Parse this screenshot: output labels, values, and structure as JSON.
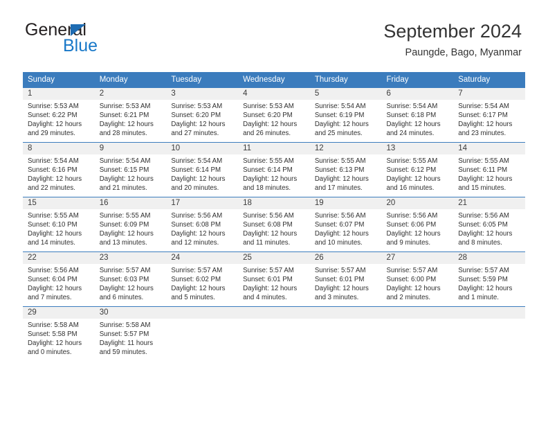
{
  "brand": {
    "word_one": "General",
    "word_two": "Blue",
    "triangle_color": "#1e6cb3",
    "blue_color": "#1878c8"
  },
  "header": {
    "month_title": "September 2024",
    "location": "Paungde, Bago, Myanmar"
  },
  "theme": {
    "header_bg": "#3b7cbd",
    "header_text": "#ffffff",
    "daynum_band_bg": "#f0f0f0",
    "grid_line": "#3b7cbd",
    "body_text": "#2f2f2f"
  },
  "weekday_headers": [
    "Sunday",
    "Monday",
    "Tuesday",
    "Wednesday",
    "Thursday",
    "Friday",
    "Saturday"
  ],
  "weeks": [
    [
      {
        "day": "1",
        "sunrise": "Sunrise: 5:53 AM",
        "sunset": "Sunset: 6:22 PM",
        "daylight_1": "Daylight: 12 hours",
        "daylight_2": "and 29 minutes."
      },
      {
        "day": "2",
        "sunrise": "Sunrise: 5:53 AM",
        "sunset": "Sunset: 6:21 PM",
        "daylight_1": "Daylight: 12 hours",
        "daylight_2": "and 28 minutes."
      },
      {
        "day": "3",
        "sunrise": "Sunrise: 5:53 AM",
        "sunset": "Sunset: 6:20 PM",
        "daylight_1": "Daylight: 12 hours",
        "daylight_2": "and 27 minutes."
      },
      {
        "day": "4",
        "sunrise": "Sunrise: 5:53 AM",
        "sunset": "Sunset: 6:20 PM",
        "daylight_1": "Daylight: 12 hours",
        "daylight_2": "and 26 minutes."
      },
      {
        "day": "5",
        "sunrise": "Sunrise: 5:54 AM",
        "sunset": "Sunset: 6:19 PM",
        "daylight_1": "Daylight: 12 hours",
        "daylight_2": "and 25 minutes."
      },
      {
        "day": "6",
        "sunrise": "Sunrise: 5:54 AM",
        "sunset": "Sunset: 6:18 PM",
        "daylight_1": "Daylight: 12 hours",
        "daylight_2": "and 24 minutes."
      },
      {
        "day": "7",
        "sunrise": "Sunrise: 5:54 AM",
        "sunset": "Sunset: 6:17 PM",
        "daylight_1": "Daylight: 12 hours",
        "daylight_2": "and 23 minutes."
      }
    ],
    [
      {
        "day": "8",
        "sunrise": "Sunrise: 5:54 AM",
        "sunset": "Sunset: 6:16 PM",
        "daylight_1": "Daylight: 12 hours",
        "daylight_2": "and 22 minutes."
      },
      {
        "day": "9",
        "sunrise": "Sunrise: 5:54 AM",
        "sunset": "Sunset: 6:15 PM",
        "daylight_1": "Daylight: 12 hours",
        "daylight_2": "and 21 minutes."
      },
      {
        "day": "10",
        "sunrise": "Sunrise: 5:54 AM",
        "sunset": "Sunset: 6:14 PM",
        "daylight_1": "Daylight: 12 hours",
        "daylight_2": "and 20 minutes."
      },
      {
        "day": "11",
        "sunrise": "Sunrise: 5:55 AM",
        "sunset": "Sunset: 6:14 PM",
        "daylight_1": "Daylight: 12 hours",
        "daylight_2": "and 18 minutes."
      },
      {
        "day": "12",
        "sunrise": "Sunrise: 5:55 AM",
        "sunset": "Sunset: 6:13 PM",
        "daylight_1": "Daylight: 12 hours",
        "daylight_2": "and 17 minutes."
      },
      {
        "day": "13",
        "sunrise": "Sunrise: 5:55 AM",
        "sunset": "Sunset: 6:12 PM",
        "daylight_1": "Daylight: 12 hours",
        "daylight_2": "and 16 minutes."
      },
      {
        "day": "14",
        "sunrise": "Sunrise: 5:55 AM",
        "sunset": "Sunset: 6:11 PM",
        "daylight_1": "Daylight: 12 hours",
        "daylight_2": "and 15 minutes."
      }
    ],
    [
      {
        "day": "15",
        "sunrise": "Sunrise: 5:55 AM",
        "sunset": "Sunset: 6:10 PM",
        "daylight_1": "Daylight: 12 hours",
        "daylight_2": "and 14 minutes."
      },
      {
        "day": "16",
        "sunrise": "Sunrise: 5:55 AM",
        "sunset": "Sunset: 6:09 PM",
        "daylight_1": "Daylight: 12 hours",
        "daylight_2": "and 13 minutes."
      },
      {
        "day": "17",
        "sunrise": "Sunrise: 5:56 AM",
        "sunset": "Sunset: 6:08 PM",
        "daylight_1": "Daylight: 12 hours",
        "daylight_2": "and 12 minutes."
      },
      {
        "day": "18",
        "sunrise": "Sunrise: 5:56 AM",
        "sunset": "Sunset: 6:08 PM",
        "daylight_1": "Daylight: 12 hours",
        "daylight_2": "and 11 minutes."
      },
      {
        "day": "19",
        "sunrise": "Sunrise: 5:56 AM",
        "sunset": "Sunset: 6:07 PM",
        "daylight_1": "Daylight: 12 hours",
        "daylight_2": "and 10 minutes."
      },
      {
        "day": "20",
        "sunrise": "Sunrise: 5:56 AM",
        "sunset": "Sunset: 6:06 PM",
        "daylight_1": "Daylight: 12 hours",
        "daylight_2": "and 9 minutes."
      },
      {
        "day": "21",
        "sunrise": "Sunrise: 5:56 AM",
        "sunset": "Sunset: 6:05 PM",
        "daylight_1": "Daylight: 12 hours",
        "daylight_2": "and 8 minutes."
      }
    ],
    [
      {
        "day": "22",
        "sunrise": "Sunrise: 5:56 AM",
        "sunset": "Sunset: 6:04 PM",
        "daylight_1": "Daylight: 12 hours",
        "daylight_2": "and 7 minutes."
      },
      {
        "day": "23",
        "sunrise": "Sunrise: 5:57 AM",
        "sunset": "Sunset: 6:03 PM",
        "daylight_1": "Daylight: 12 hours",
        "daylight_2": "and 6 minutes."
      },
      {
        "day": "24",
        "sunrise": "Sunrise: 5:57 AM",
        "sunset": "Sunset: 6:02 PM",
        "daylight_1": "Daylight: 12 hours",
        "daylight_2": "and 5 minutes."
      },
      {
        "day": "25",
        "sunrise": "Sunrise: 5:57 AM",
        "sunset": "Sunset: 6:01 PM",
        "daylight_1": "Daylight: 12 hours",
        "daylight_2": "and 4 minutes."
      },
      {
        "day": "26",
        "sunrise": "Sunrise: 5:57 AM",
        "sunset": "Sunset: 6:01 PM",
        "daylight_1": "Daylight: 12 hours",
        "daylight_2": "and 3 minutes."
      },
      {
        "day": "27",
        "sunrise": "Sunrise: 5:57 AM",
        "sunset": "Sunset: 6:00 PM",
        "daylight_1": "Daylight: 12 hours",
        "daylight_2": "and 2 minutes."
      },
      {
        "day": "28",
        "sunrise": "Sunrise: 5:57 AM",
        "sunset": "Sunset: 5:59 PM",
        "daylight_1": "Daylight: 12 hours",
        "daylight_2": "and 1 minute."
      }
    ],
    [
      {
        "day": "29",
        "sunrise": "Sunrise: 5:58 AM",
        "sunset": "Sunset: 5:58 PM",
        "daylight_1": "Daylight: 12 hours",
        "daylight_2": "and 0 minutes."
      },
      {
        "day": "30",
        "sunrise": "Sunrise: 5:58 AM",
        "sunset": "Sunset: 5:57 PM",
        "daylight_1": "Daylight: 11 hours",
        "daylight_2": "and 59 minutes."
      },
      {
        "day": "",
        "sunrise": "",
        "sunset": "",
        "daylight_1": "",
        "daylight_2": ""
      },
      {
        "day": "",
        "sunrise": "",
        "sunset": "",
        "daylight_1": "",
        "daylight_2": ""
      },
      {
        "day": "",
        "sunrise": "",
        "sunset": "",
        "daylight_1": "",
        "daylight_2": ""
      },
      {
        "day": "",
        "sunrise": "",
        "sunset": "",
        "daylight_1": "",
        "daylight_2": ""
      },
      {
        "day": "",
        "sunrise": "",
        "sunset": "",
        "daylight_1": "",
        "daylight_2": ""
      }
    ]
  ]
}
